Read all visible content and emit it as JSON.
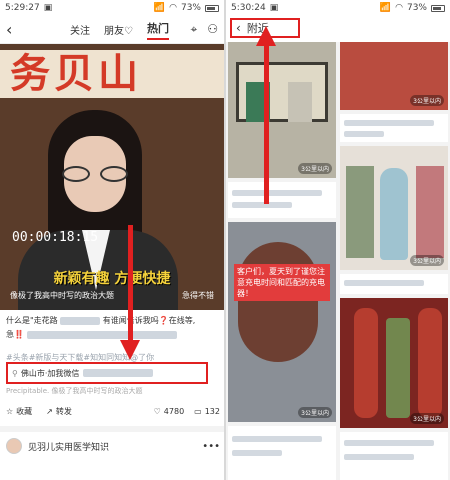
{
  "left_screen": {
    "status": {
      "time": "5:29:27",
      "battery": "73%"
    },
    "nav": {
      "tabs": [
        "关注",
        "朋友♡",
        "热门"
      ],
      "active_tab": 2
    },
    "video": {
      "background_text": "务贝山",
      "timer": "00:00:18:15",
      "caption_main": "新颖有趣  方便快捷",
      "caption_sub_left": "像极了我高中时写的政治大题",
      "caption_sub_right": "急得不错"
    },
    "post": {
      "line1_prefix": "什么是\"走花路",
      "line1_mid": "有谁闻",
      "line1_suffix": "告诉我吗",
      "line1_mark": "❓",
      "line1_end": "在线等,",
      "line2_prefix": "急",
      "line2_mark": "‼️",
      "tags": "#头条#新版与天下载#知知同知知@了你",
      "location": "佛山市·加我微信",
      "extra_line": "Precipitable. 像极了我高中时写的政治大题",
      "collect_label": "收藏",
      "share_label": "转发",
      "likes": "4780",
      "comments": "132"
    },
    "author": {
      "name": "见羽儿实用医学知识",
      "more": "•••"
    }
  },
  "right_screen": {
    "status": {
      "time": "5:30:24",
      "battery": "73%"
    },
    "nav": {
      "title": "附近"
    },
    "tiles": {
      "t1_badge": "3公里以内",
      "t2_badge": "3公里以内",
      "t3_badge": "3公里以内",
      "t4_badge": "3公里以内",
      "t5_badge": "3公里以内",
      "t5_overlay": "客户们，夏天到了谨您注意充电时间和匹配的充电器！"
    }
  },
  "colors": {
    "accent": "#e02020"
  },
  "icons": [
    "back-icon",
    "location-icon",
    "person-icon",
    "signal-icon",
    "wifi-icon",
    "battery-icon",
    "star-icon",
    "share-icon",
    "heart-icon",
    "comment-icon",
    "pin-icon"
  ]
}
